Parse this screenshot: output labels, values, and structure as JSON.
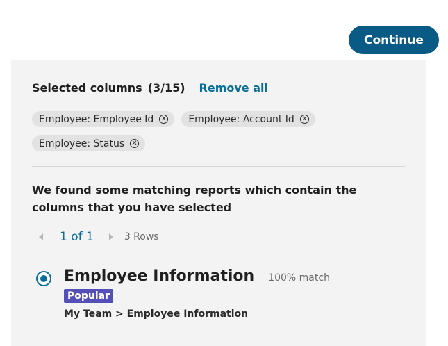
{
  "continue_button": {
    "label": "Continue"
  },
  "selected_columns": {
    "title": "Selected columns",
    "count": "(3/15)",
    "remove_all_label": "Remove all",
    "chips": [
      {
        "label": "Employee: Employee Id"
      },
      {
        "label": "Employee: Account Id"
      },
      {
        "label": "Employee: Status"
      }
    ],
    "remove_icon": "circle-x-icon"
  },
  "matching": {
    "message": "We found some matching reports which contain the columns that you have selected",
    "pager": {
      "prev_icon": "caret-left-icon",
      "page": "1 of 1",
      "next_icon": "caret-right-icon",
      "rows": "3 Rows"
    },
    "results": [
      {
        "title": "Employee Information",
        "match": "100% match",
        "badge": "Popular",
        "path": "My Team > Employee Information",
        "selected": true
      }
    ]
  },
  "colors": {
    "primary": "#0a5a86",
    "link": "#0a6e99",
    "badge": "#5550b8",
    "panel_bg": "#f3f3f3",
    "chip_bg": "#e2e2e2"
  }
}
